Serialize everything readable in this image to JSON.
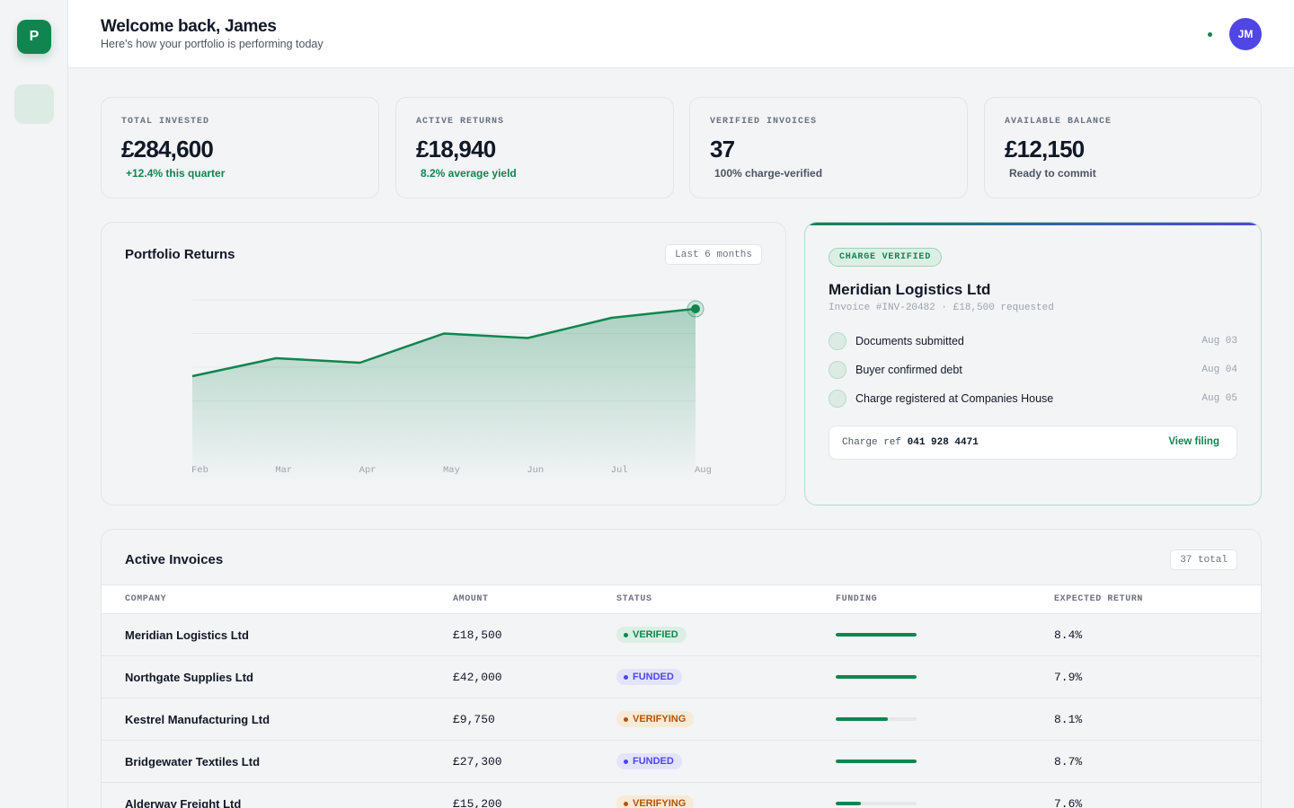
{
  "sidebar": {
    "logo_letter": "P"
  },
  "header": {
    "title": "Welcome back, James",
    "subtitle": "Here's how your portfolio is performing today",
    "avatar_initials": "JM"
  },
  "stats": [
    {
      "label": "TOTAL INVESTED",
      "value": "£284,600",
      "note": "+12.4% this quarter",
      "note_color": "#11854f"
    },
    {
      "label": "ACTIVE RETURNS",
      "value": "£18,940",
      "note": "8.2% average yield",
      "note_color": "#11854f"
    },
    {
      "label": "VERIFIED INVOICES",
      "value": "37",
      "note": "100% charge-verified",
      "note_color": "#4b5563"
    },
    {
      "label": "AVAILABLE BALANCE",
      "value": "£12,150",
      "note": "Ready to commit",
      "note_color": "#4b5563"
    }
  ],
  "returns_card": {
    "title": "Portfolio Returns",
    "range": "Last 6 months"
  },
  "chart_data": {
    "type": "area",
    "categories": [
      "Feb",
      "Mar",
      "Apr",
      "May",
      "Jun",
      "Jul",
      "Aug"
    ],
    "series": [
      {
        "values": [
          2.6,
          3.4,
          3.2,
          4.5,
          4.3,
          5.2,
          5.6
        ]
      }
    ],
    "ylim": [
      0,
      6
    ],
    "gridlines": [
      1.5,
      3.0,
      4.5,
      6.0
    ],
    "grid": true,
    "highlight_last_point": true,
    "colors": {
      "line": "#11854f",
      "fill": "#11854f",
      "grid": "#e5e7eb",
      "tick": "#9ca3af"
    }
  },
  "verification": {
    "badge": "CHARGE VERIFIED",
    "company": "Meridian Logistics Ltd",
    "meta": "Invoice #INV-20482 · £18,500 requested",
    "steps": [
      {
        "label": "Documents submitted",
        "date": "Aug 03"
      },
      {
        "label": "Buyer confirmed debt",
        "date": "Aug 04"
      },
      {
        "label": "Charge registered at Companies House",
        "date": "Aug 05"
      }
    ],
    "ref_label": "Charge ref",
    "ref_value": "041 928 4471",
    "ref_link": "View filing"
  },
  "invoices": {
    "title": "Active Invoices",
    "count": "37 total",
    "columns": [
      "COMPANY",
      "AMOUNT",
      "STATUS",
      "FUNDING",
      "EXPECTED RETURN"
    ],
    "rows": [
      {
        "company": "Meridian Logistics Ltd",
        "amount": "£18,500",
        "status": "VERIFIED",
        "funding": 1.0,
        "return": "8.4%"
      },
      {
        "company": "Northgate Supplies Ltd",
        "amount": "£42,000",
        "status": "FUNDED",
        "funding": 1.0,
        "return": "7.9%"
      },
      {
        "company": "Kestrel Manufacturing Ltd",
        "amount": "£9,750",
        "status": "VERIFYING",
        "funding": 0.64,
        "return": "8.1%"
      },
      {
        "company": "Bridgewater Textiles Ltd",
        "amount": "£27,300",
        "status": "FUNDED",
        "funding": 1.0,
        "return": "8.7%"
      },
      {
        "company": "Alderway Freight Ltd",
        "amount": "£15,200",
        "status": "VERIFYING",
        "funding": 0.31,
        "return": "7.6%"
      }
    ],
    "status_colors": {
      "VERIFIED": {
        "bg": "#dcefe4",
        "fg": "#11854f"
      },
      "FUNDED": {
        "bg": "#e3e4fb",
        "fg": "#4f46e5"
      },
      "VERIFYING": {
        "bg": "#f7ead6",
        "fg": "#b45309"
      }
    }
  }
}
